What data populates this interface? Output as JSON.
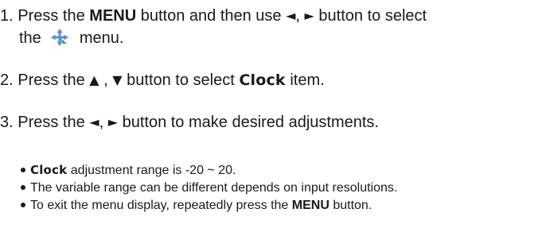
{
  "step1": {
    "line1_a": "1. Press the ",
    "line1_menu": "MENU",
    "line1_b": " button and then use ",
    "arrow_left": "◄",
    "comma": ", ",
    "arrow_right": "►",
    "line1_c": " button to select",
    "line2_a": "the",
    "menu_icon": "position-menu-icon",
    "line2_b": "menu."
  },
  "step2": {
    "prefix": "2. Press the ",
    "arrow_up": "▲",
    "comma": " , ",
    "arrow_down": "▼",
    "mid": " button to select ",
    "item": "Clock",
    "suffix": " item."
  },
  "step3": {
    "prefix": "3. Press the  ",
    "arrow_left": "◄",
    "comma": ", ",
    "arrow_right": "►",
    "suffix": " button to make desired adjustments."
  },
  "notes": {
    "note1_item": "Clock",
    "note1_text": " adjustment range is -20 ~ 20.",
    "note2_text": "The variable range can be different depends on input resolutions.",
    "note3_a": "To exit the menu display, repeatedly press the ",
    "note3_menu": "MENU",
    "note3_b": " button."
  },
  "colors": {
    "text": "#1a1a1a",
    "icon_blue": "#5b8fd0",
    "icon_green": "#3fa24a"
  }
}
